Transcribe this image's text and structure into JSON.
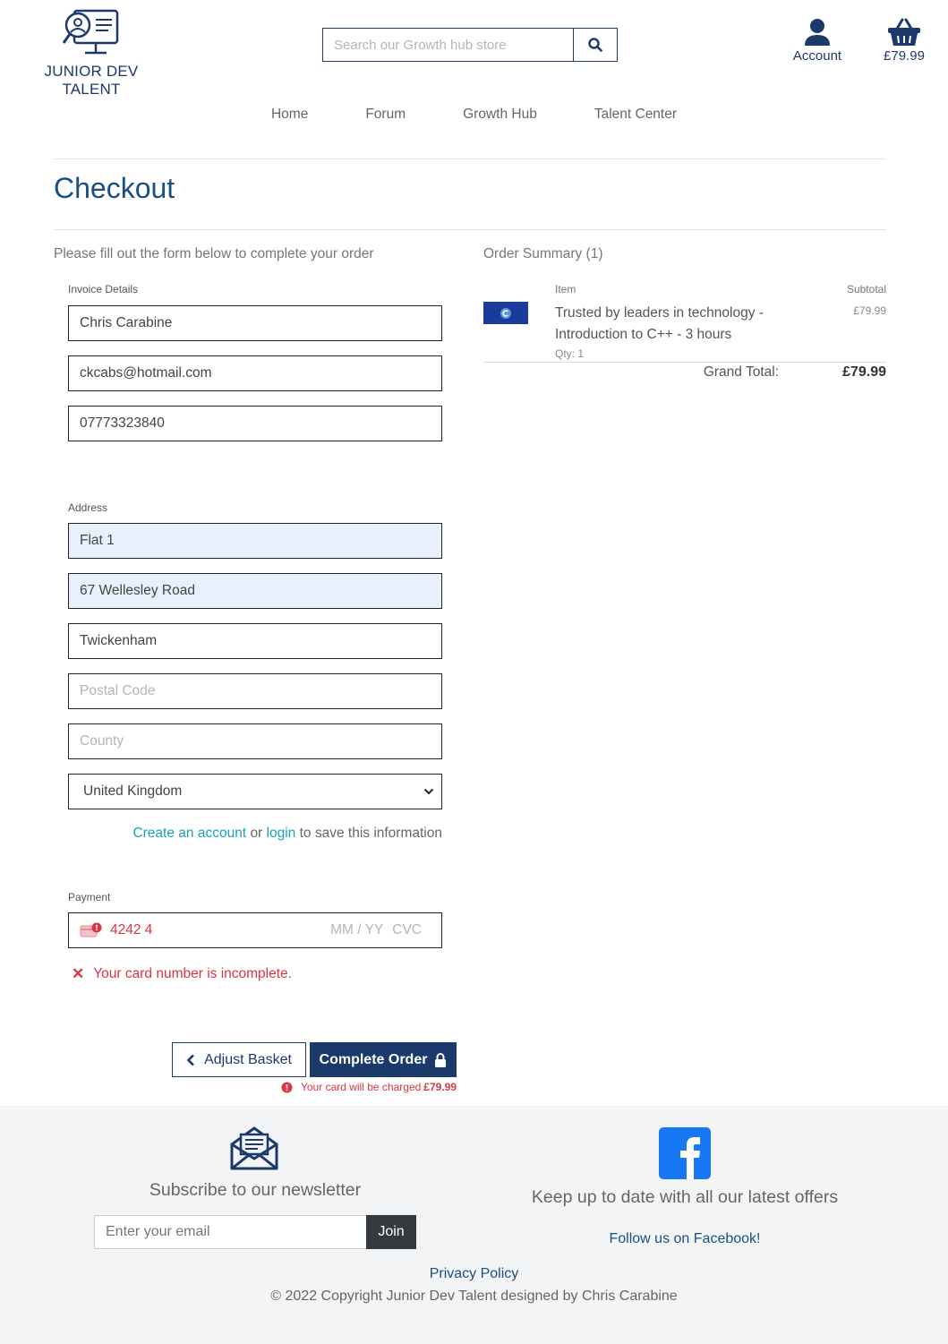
{
  "header": {
    "logo_text": "JUNIOR DEV TALENT",
    "search_placeholder": "Search our Growth hub store",
    "account_label": "Account",
    "basket_total": "£79.99"
  },
  "nav": {
    "items": [
      "Home",
      "Forum",
      "Growth Hub",
      "Talent Center"
    ]
  },
  "page": {
    "title": "Checkout",
    "intro": "Please fill out the form below to complete your order"
  },
  "invoice": {
    "label": "Invoice Details",
    "name": "Chris Carabine",
    "email": "ckcabs@hotmail.com",
    "phone": "07773323840"
  },
  "address": {
    "label": "Address",
    "line1": "Flat 1",
    "line2": "67 Wellesley Road",
    "town": "Twickenham",
    "postal_placeholder": "Postal Code",
    "county_placeholder": "County",
    "country": "United Kingdom"
  },
  "save_info": {
    "create_link": "Create an account",
    "or": "or",
    "login_link": "login",
    "suffix": "to save this information"
  },
  "payment": {
    "label": "Payment",
    "card_number": "4242 4",
    "expiry_placeholder": "MM / YY",
    "cvc_placeholder": "CVC",
    "error": "Your card number is incomplete."
  },
  "actions": {
    "adjust_label": "Adjust Basket",
    "complete_label": "Complete Order",
    "charge_note": "Your card will be charged",
    "charge_amount": "£79.99"
  },
  "summary": {
    "title": "Order Summary (1)",
    "col_item": "Item",
    "col_subtotal": "Subtotal",
    "item_name": "Trusted by leaders in technology - Introduction to C++ - 3 hours",
    "item_qty": "Qty: 1",
    "item_price": "£79.99",
    "grand_label": "Grand Total:",
    "grand_value": "£79.99"
  },
  "footer": {
    "newsletter_title": "Subscribe to our newsletter",
    "email_placeholder": "Enter your email",
    "join_label": "Join",
    "facebook_title": "Keep up to date with all our latest offers",
    "facebook_link": "Follow us on Facebook!",
    "privacy": "Privacy Policy",
    "copyright": "© 2022 Copyright Junior Dev Talent designed by Chris Carabine"
  },
  "colors": {
    "brand": "#1b3a6b",
    "accent_link": "#17a2b8",
    "error": "#dc3545",
    "footer_bg": "#f3f4f6",
    "facebook": "#1877f2"
  }
}
